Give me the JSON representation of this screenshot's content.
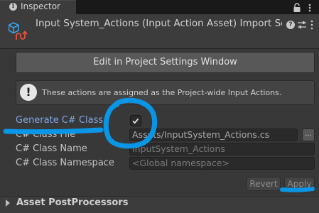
{
  "tab": {
    "label": "Inspector",
    "icon": "info-icon"
  },
  "header": {
    "title": "Input System_Actions (Input Action Asset) Import Settings"
  },
  "edit_button_label": "Edit in Project Settings Window",
  "info_message": "These actions are assigned as the Project-wide Input Actions.",
  "fields": {
    "generate_label": "Generate C# Class",
    "generate_checked": true,
    "file_label": "C# Class File",
    "file_value": "Assets/InputSystem_Actions.cs",
    "browse_label": "...",
    "name_label": "C# Class Name",
    "name_placeholder": "InputSystem_Actions",
    "namespace_label": "C# Class Namespace",
    "namespace_placeholder": "<Global namespace>"
  },
  "buttons": {
    "revert": "Revert",
    "apply": "Apply"
  },
  "postprocessors_label": "Asset PostProcessors",
  "colors": {
    "background": "#383838",
    "label_highlight": "#7ea7e8",
    "annotation_ink": "#0a96e6"
  }
}
